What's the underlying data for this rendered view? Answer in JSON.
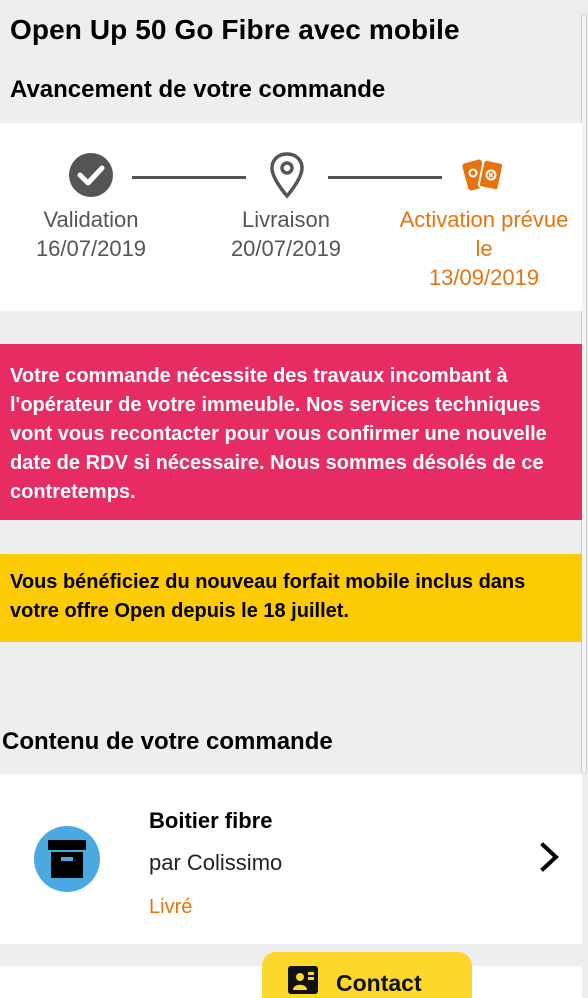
{
  "header": {
    "title": "Open Up 50 Go Fibre avec mobile",
    "progress_title": "Avancement de votre commande"
  },
  "progress": {
    "steps": [
      {
        "icon": "check-circle-icon",
        "label": "Validation",
        "date": "16/07/2019",
        "status": "done"
      },
      {
        "icon": "location-pin-icon",
        "label": "Livraison",
        "date": "20/07/2019",
        "status": "done"
      },
      {
        "icon": "activation-cards-icon",
        "label_line1": "Activation prévue",
        "label_line2": "le",
        "date": "13/09/2019",
        "status": "active"
      }
    ]
  },
  "alerts": {
    "works_notice": "Votre commande nécessite des travaux incombant à l'opérateur de votre immeuble. Nos services techniques vont vous recontacter pour vous confirmer une nouvelle date de RDV si nécessaire. Nous sommes désolés de ce contretemps.",
    "mobile_notice": "Vous bénéficiez du nouveau forfait mobile inclus dans votre offre Open depuis le 18 juillet."
  },
  "order_content": {
    "title": "Contenu de votre commande",
    "items": [
      {
        "icon": "box-icon",
        "name": "Boitier fibre",
        "carrier": "par Colissimo",
        "status": "Livré"
      }
    ]
  },
  "contact": {
    "label": "Contact",
    "icon": "contact-person-icon"
  },
  "colors": {
    "orange": "#e8730d",
    "pink": "#e72c64",
    "yellow": "#fccb03",
    "blue": "#4aa9e0"
  }
}
